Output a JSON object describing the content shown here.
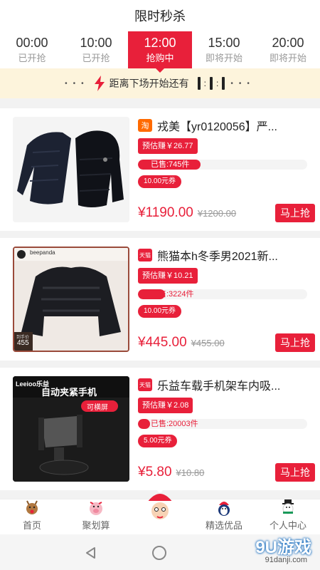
{
  "header": {
    "title": "限时秒杀"
  },
  "time_tabs": [
    {
      "time": "00:00",
      "status": "已开抢"
    },
    {
      "time": "10:00",
      "status": "已开抢"
    },
    {
      "time": "12:00",
      "status": "抢购中",
      "active": true
    },
    {
      "time": "15:00",
      "status": "即将开始"
    },
    {
      "time": "20:00",
      "status": "即将开始"
    }
  ],
  "countdown": {
    "label": "距离下场开始还有"
  },
  "products": [
    {
      "platform": "淘",
      "platform_type": "taobao",
      "name": "戎美【yr0120056】严...",
      "earn": "预估赚￥26.77",
      "sold": "已售:745件",
      "sold_ratio": 0.37,
      "coupon": "10.00元券",
      "price": "¥1190.00",
      "original_price": "¥1200.00",
      "buy_label": "马上抢"
    },
    {
      "platform": "天猫",
      "platform_type": "tmall",
      "name": "熊猫本h冬季男2021新...",
      "earn": "预估赚￥10.21",
      "sold": "已售:3224件",
      "sold_ratio": 0.16,
      "coupon": "10.00元券",
      "price": "¥445.00",
      "original_price": "¥455.00",
      "buy_label": "马上抢",
      "thumb_brand": "beepanda",
      "thumb_price_label": "到手价",
      "thumb_price": "455"
    },
    {
      "platform": "天猫",
      "platform_type": "tmall",
      "name": "乐益车载手机架车内吸...",
      "earn": "预估赚￥2.08",
      "sold": "已售:20003件",
      "sold_ratio": 0.07,
      "coupon": "5.00元券",
      "price": "¥5.80",
      "original_price": "¥10.80",
      "buy_label": "马上抢",
      "thumb_brand": "Leeioo乐益",
      "thumb_headline": "自动夹紧手机",
      "thumb_tag": "可横屏"
    }
  ],
  "nav": [
    {
      "label": "首页",
      "icon": "reindeer-icon"
    },
    {
      "label": "聚划算",
      "icon": "pig-icon"
    },
    {
      "label": "",
      "icon": "santa-icon"
    },
    {
      "label": "精选优品",
      "icon": "penguin-icon"
    },
    {
      "label": "个人中心",
      "icon": "snowman-icon"
    }
  ],
  "watermark": {
    "main": "9U游戏",
    "sub": "91danji.com"
  },
  "colors": {
    "accent": "#e8203a",
    "banner_bg": "#fdf4dc"
  }
}
